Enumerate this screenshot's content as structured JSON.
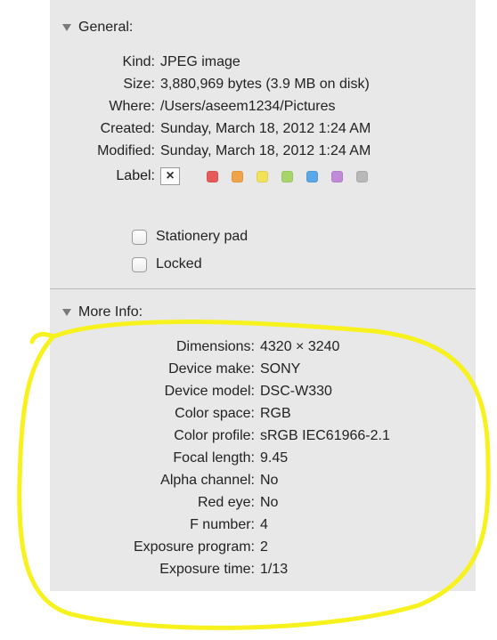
{
  "general": {
    "header": "General:",
    "rows": [
      {
        "label": "Kind:",
        "value": "JPEG image"
      },
      {
        "label": "Size:",
        "value": "3,880,969 bytes (3.9 MB on disk)"
      },
      {
        "label": "Where:",
        "value": "/Users/aseem1234/Pictures"
      },
      {
        "label": "Created:",
        "value": "Sunday, March 18, 2012 1:24 AM"
      },
      {
        "label": "Modified:",
        "value": "Sunday, March 18, 2012 1:24 AM"
      }
    ],
    "label_label": "Label:",
    "label_clear": "×",
    "label_colors": [
      "#e65a5a",
      "#f0a348",
      "#f2e25a",
      "#a8d56a",
      "#5aa8e8",
      "#c08ad8",
      "#b8b8b8"
    ],
    "stationery_pad": "Stationery pad",
    "locked": "Locked"
  },
  "more_info": {
    "header": "More Info:",
    "rows": [
      {
        "label": "Dimensions:",
        "value": "4320 × 3240"
      },
      {
        "label": "Device make:",
        "value": "SONY"
      },
      {
        "label": "Device model:",
        "value": "DSC-W330"
      },
      {
        "label": "Color space:",
        "value": "RGB"
      },
      {
        "label": "Color profile:",
        "value": "sRGB IEC61966-2.1"
      },
      {
        "label": "Focal length:",
        "value": "9.45"
      },
      {
        "label": "Alpha channel:",
        "value": "No"
      },
      {
        "label": "Red eye:",
        "value": "No"
      },
      {
        "label": "F number:",
        "value": "4"
      },
      {
        "label": "Exposure program:",
        "value": "2"
      },
      {
        "label": "Exposure time:",
        "value": "1/13"
      }
    ]
  },
  "colors": {
    "panel_bg": "#e8e8e8",
    "highlight": "#f7f21e"
  }
}
